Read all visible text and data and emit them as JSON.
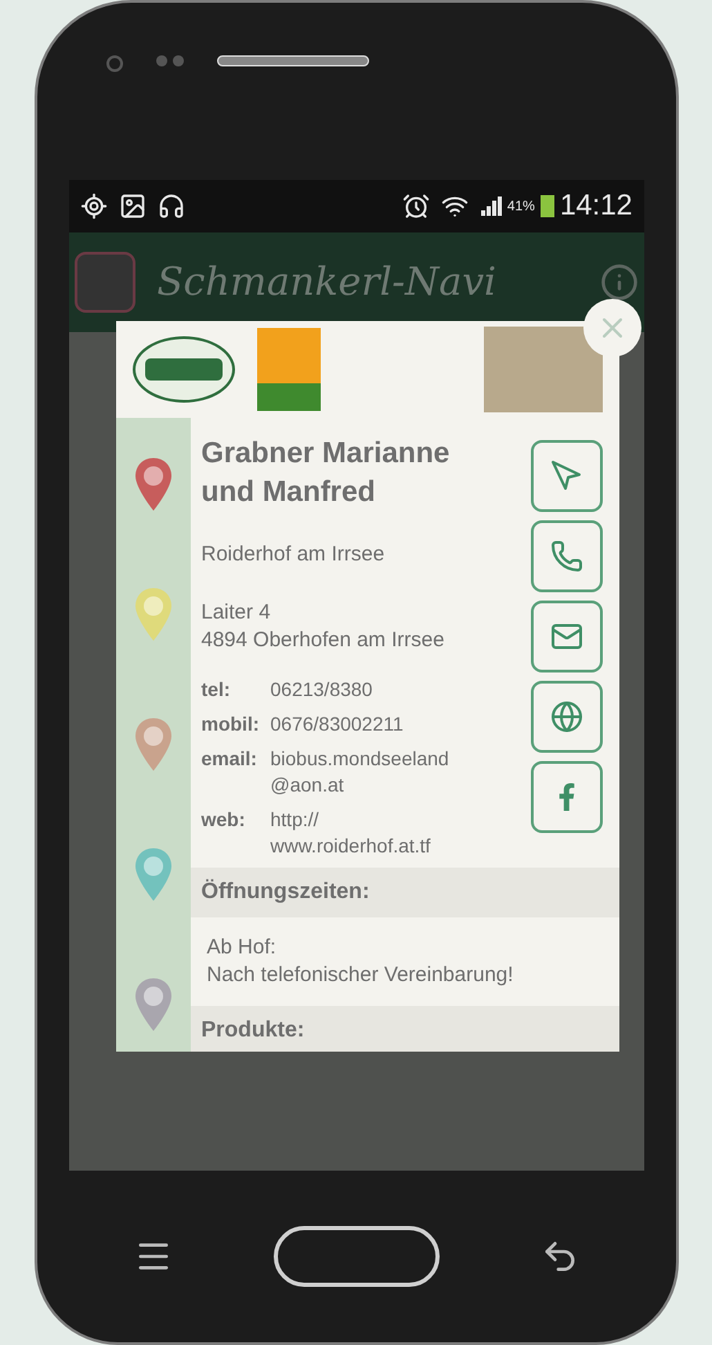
{
  "status_bar": {
    "battery": "41%",
    "time": "14:12"
  },
  "app_bar": {
    "title": "Schmankerl-Navi"
  },
  "popup": {
    "name": "Grabner Marianne und Manfred",
    "farm": "Roiderhof am Irrsee",
    "address": [
      "Laiter 4",
      "4894 Oberhofen am Irrsee"
    ],
    "contacts": [
      {
        "label": "tel:",
        "value": [
          "06213/8380"
        ]
      },
      {
        "label": "mobil:",
        "value": [
          "0676/83002211"
        ]
      },
      {
        "label": "email:",
        "value": [
          "biobus.mondseeland",
          "@aon.at"
        ]
      },
      {
        "label": "web:",
        "value": [
          "http://",
          "www.roiderhof.at.tf"
        ]
      }
    ],
    "actions": [
      {
        "kind": "navigate"
      },
      {
        "kind": "call"
      },
      {
        "kind": "email"
      },
      {
        "kind": "web"
      },
      {
        "kind": "facebook"
      }
    ],
    "sections": [
      {
        "heading": "Öffnungszeiten:",
        "lines": [
          "Ab Hof:",
          "Nach telefonischer Vereinbarung!"
        ]
      },
      {
        "heading": "Produkte:"
      }
    ]
  }
}
